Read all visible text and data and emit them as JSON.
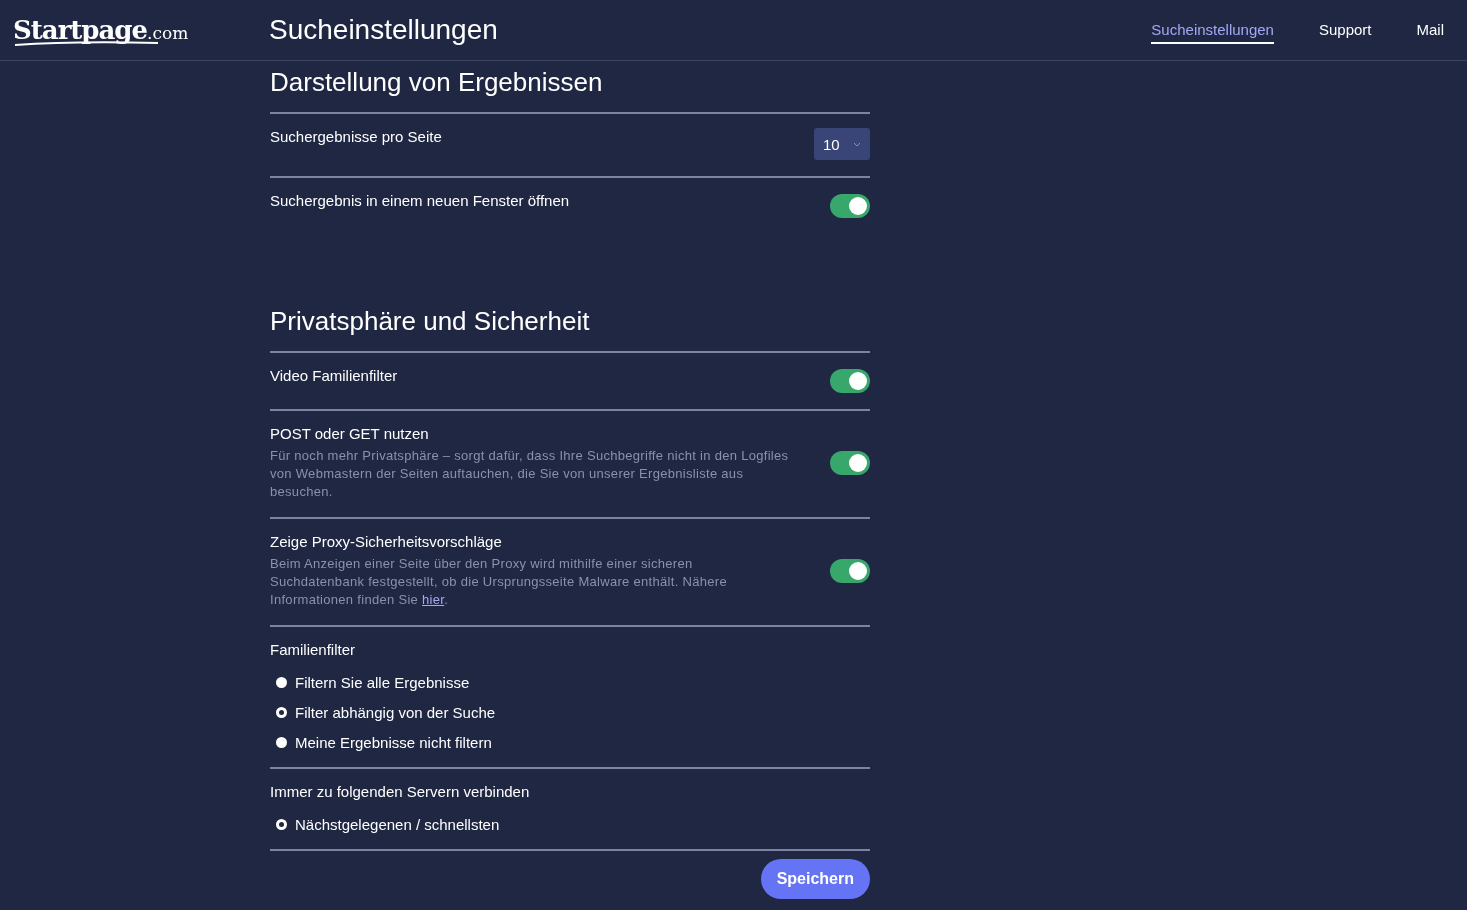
{
  "header": {
    "logo": {
      "name": "Startpage",
      "suffix": ".com"
    },
    "title": "Sucheinstellungen",
    "nav": [
      {
        "label": "Sucheinstellungen",
        "selected": true
      },
      {
        "label": "Support",
        "selected": false
      },
      {
        "label": "Mail",
        "selected": false
      }
    ]
  },
  "sections": [
    {
      "title": "Darstellung von Ergebnissen",
      "rows": [
        {
          "kind": "select",
          "label": "Suchergebnisse pro Seite",
          "value": "10"
        },
        {
          "kind": "toggle",
          "label": "Suchergebnis in einem neuen Fenster öffnen",
          "on": true
        }
      ]
    },
    {
      "title": "Privatsphäre und Sicherheit",
      "rows": [
        {
          "kind": "toggle",
          "label": "Video Familienfilter",
          "on": true
        },
        {
          "kind": "toggle",
          "label": "POST oder GET nutzen",
          "on": true,
          "description": "Für noch mehr Privatsphäre – sorgt dafür, dass Ihre Suchbegriffe nicht in den Logfiles von Webmastern der Seiten auftauchen, die Sie von unserer Ergebnisliste aus besuchen."
        },
        {
          "kind": "toggle",
          "label": "Zeige Proxy-Sicherheitsvorschläge",
          "on": true,
          "description": "Beim Anzeigen einer Seite über den Proxy wird mithilfe einer sicheren Suchdatenbank festgestellt, ob die Ursprungsseite Malware enthält. Nähere Informationen finden Sie ",
          "link": "hier",
          "description_end": "."
        },
        {
          "kind": "radio",
          "label": "Familienfilter",
          "options": [
            {
              "label": "Filtern Sie alle Ergebnisse",
              "selected": false
            },
            {
              "label": "Filter abhängig von der Suche",
              "selected": true
            },
            {
              "label": "Meine Ergebnisse nicht filtern",
              "selected": false
            }
          ]
        },
        {
          "kind": "radio",
          "label": "Immer zu folgenden Servern verbinden",
          "options": [
            {
              "label": "Nächstgelegenen / schnellsten",
              "selected": true
            }
          ]
        }
      ]
    }
  ],
  "save_button": "Speichern"
}
